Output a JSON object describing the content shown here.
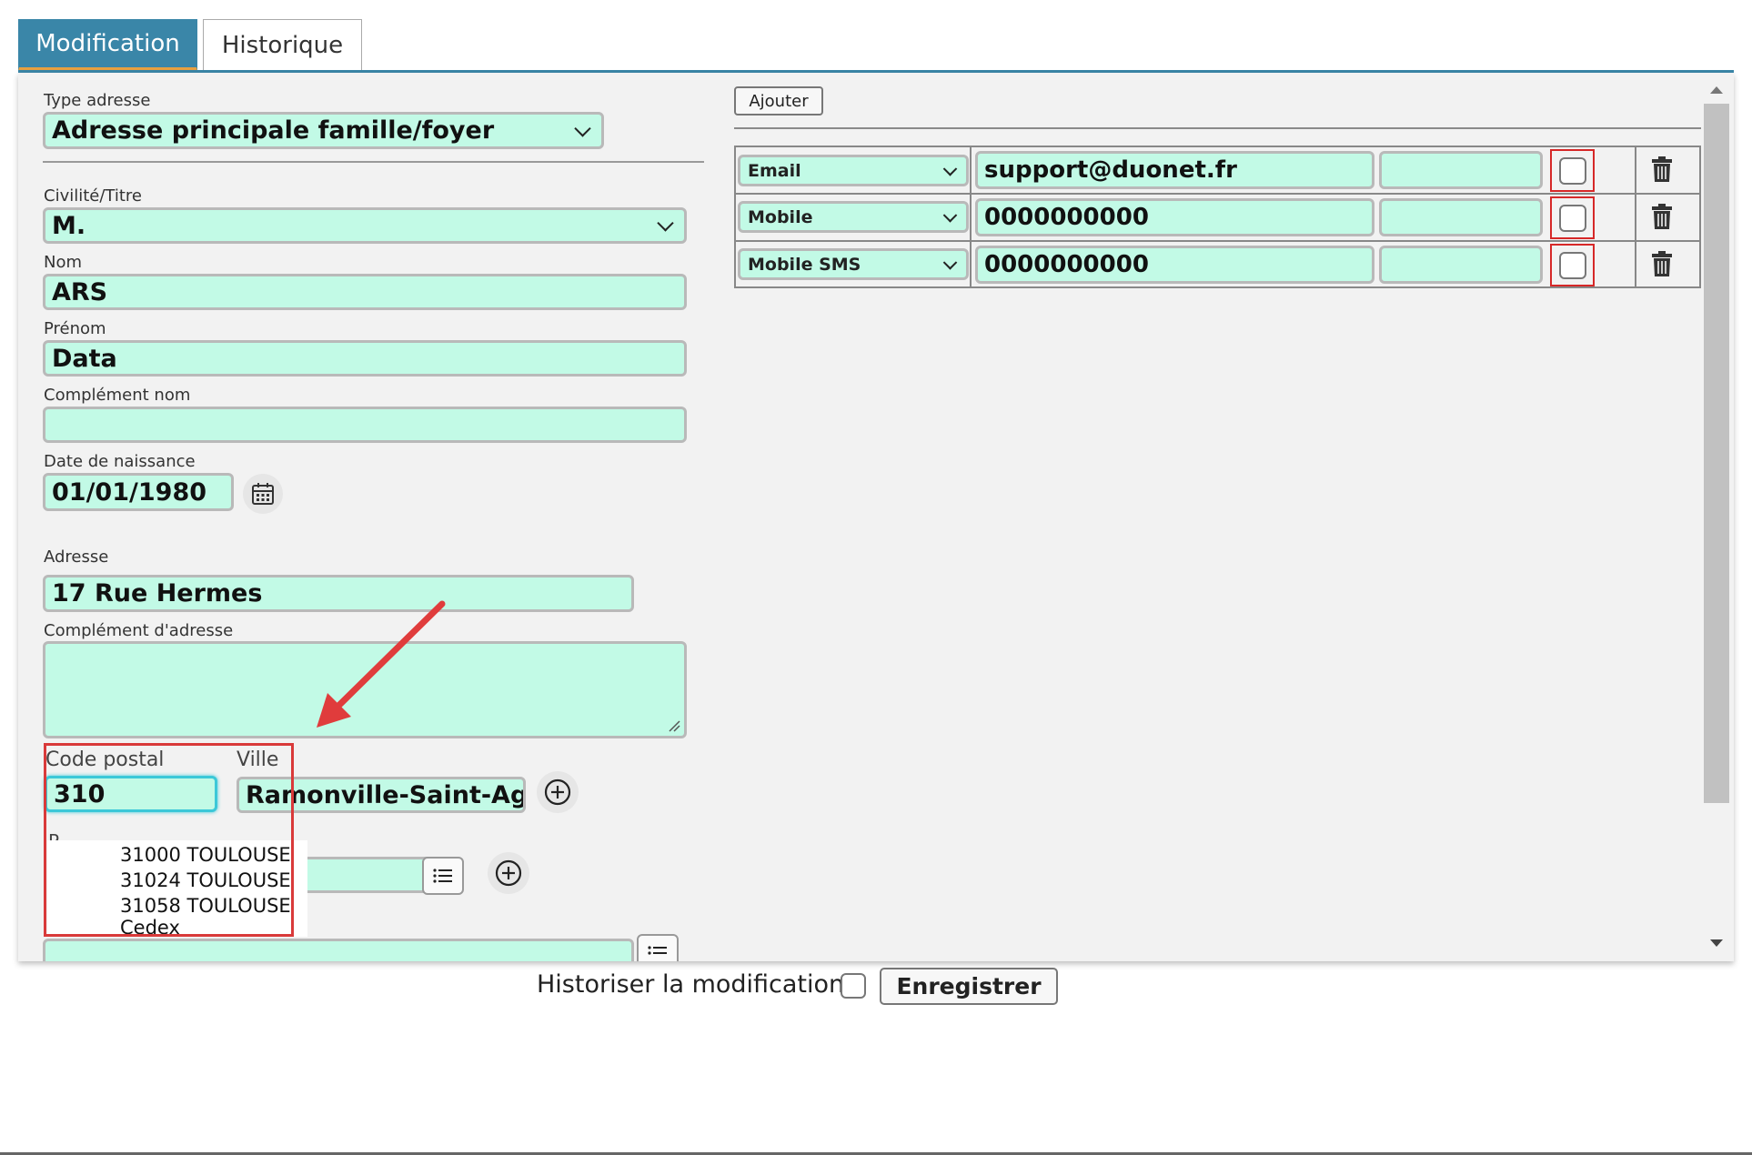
{
  "tabs": [
    {
      "label": "Modification",
      "active": true
    },
    {
      "label": "Historique",
      "active": false
    }
  ],
  "form": {
    "type_adresse": {
      "label": "Type adresse",
      "value": "Adresse principale famille/foyer"
    },
    "civilite": {
      "label": "Civilité/Titre",
      "value": "M."
    },
    "nom": {
      "label": "Nom",
      "value": "ARS"
    },
    "prenom": {
      "label": "Prénom",
      "value": "Data"
    },
    "complement_nom": {
      "label": "Complément nom",
      "value": ""
    },
    "date_naissance": {
      "label": "Date de naissance",
      "value": "01/01/1980"
    },
    "adresse": {
      "label": "Adresse",
      "value": "17 Rue Hermes"
    },
    "complement_adresse": {
      "label": "Complément d'adresse",
      "value": ""
    },
    "code_postal": {
      "label": "Code postal",
      "value": "310"
    },
    "ville": {
      "label": "Ville",
      "value": "Ramonville-Saint-Ag"
    },
    "hidden_label_fragment": "P"
  },
  "postal_suggestions": [
    {
      "code": "31000",
      "city": "TOULOUSE"
    },
    {
      "code": "31024",
      "city": "TOULOUSE"
    },
    {
      "code": "31058",
      "city": "TOULOUSE",
      "extra": "Cedex"
    }
  ],
  "contacts": {
    "add_label": "Ajouter",
    "rows": [
      {
        "type": "Email",
        "value": "support@duonet.fr",
        "extra": "",
        "checked": false
      },
      {
        "type": "Mobile",
        "value": "0000000000",
        "extra": "",
        "checked": false
      },
      {
        "type": "Mobile SMS",
        "value": "0000000000",
        "extra": "",
        "checked": false
      }
    ]
  },
  "footer": {
    "historiser_label": "Historiser la modification",
    "historiser_checked": false,
    "save_label": "Enregistrer"
  },
  "colors": {
    "accent": "#3a86a8",
    "field_bg": "#c2fae6",
    "annotation_red": "#d93a3a"
  }
}
